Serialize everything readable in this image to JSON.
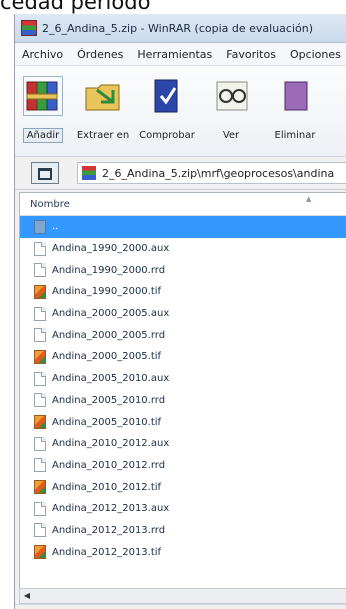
{
  "heading": "cedad período",
  "window": {
    "title": "2_6_Andina_5.zip - WinRAR (copia de evaluación)"
  },
  "menu": [
    "Archivo",
    "Órdenes",
    "Herramientas",
    "Favoritos",
    "Opciones"
  ],
  "toolbar": [
    {
      "label": "Añadir",
      "icon": "archive-books-icon"
    },
    {
      "label": "Extraer en",
      "icon": "extract-folder-icon"
    },
    {
      "label": "Comprobar",
      "icon": "test-book-icon"
    },
    {
      "label": "Ver",
      "icon": "glasses-view-icon"
    },
    {
      "label": "Eliminar",
      "icon": "delete-icon"
    }
  ],
  "address": {
    "path": "2_6_Andina_5.zip\\mrf\\geoprocesos\\andina"
  },
  "list": {
    "column_name": "Nombre",
    "up_dir": "..",
    "files": [
      {
        "name": "Andina_1990_2000.aux",
        "type": "doc"
      },
      {
        "name": "Andina_1990_2000.rrd",
        "type": "doc"
      },
      {
        "name": "Andina_1990_2000.tif",
        "type": "tif"
      },
      {
        "name": "Andina_2000_2005.aux",
        "type": "doc"
      },
      {
        "name": "Andina_2000_2005.rrd",
        "type": "doc"
      },
      {
        "name": "Andina_2000_2005.tif",
        "type": "tif"
      },
      {
        "name": "Andina_2005_2010.aux",
        "type": "doc"
      },
      {
        "name": "Andina_2005_2010.rrd",
        "type": "doc"
      },
      {
        "name": "Andina_2005_2010.tif",
        "type": "tif"
      },
      {
        "name": "Andina_2010_2012.aux",
        "type": "doc"
      },
      {
        "name": "Andina_2010_2012.rrd",
        "type": "doc"
      },
      {
        "name": "Andina_2010_2012.tif",
        "type": "tif"
      },
      {
        "name": "Andina_2012_2013.aux",
        "type": "doc"
      },
      {
        "name": "Andina_2012_2013.rrd",
        "type": "doc"
      },
      {
        "name": "Andina_2012_2013.tif",
        "type": "tif"
      }
    ]
  },
  "colors": {
    "selection": "#3399ff",
    "titlebar": "#c9d9ec"
  }
}
